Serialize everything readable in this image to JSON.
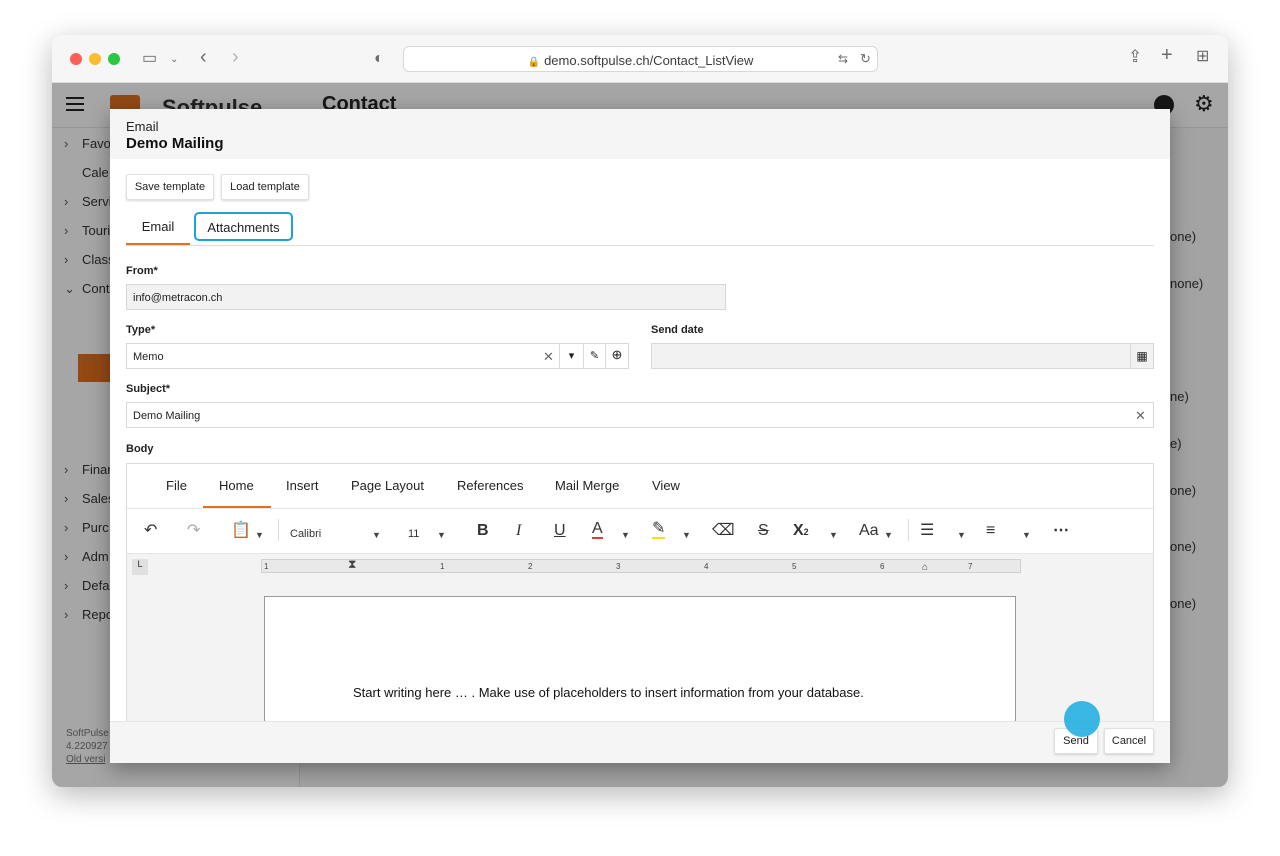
{
  "browser": {
    "url": "demo.softpulse.ch/Contact_ListView"
  },
  "app": {
    "logo_text": "Softpulse",
    "page_title": "Contact"
  },
  "sidebar": {
    "items": [
      "Favo",
      "Cale",
      "Servi",
      "Touri",
      "Class",
      "Cont",
      "Finar",
      "Sales",
      "Purc",
      "Adm",
      "Defa",
      "Repo"
    ],
    "footer": [
      "SoftPulse",
      "4.220927",
      "Old versi"
    ]
  },
  "background_fragments": [
    "one)",
    "none)",
    "ne)",
    "e)",
    "one)",
    "one)",
    "one)"
  ],
  "modal": {
    "kind": "Email",
    "title": "Demo Mailing",
    "save_template": "Save template",
    "load_template": "Load template",
    "tabs": {
      "email": "Email",
      "attachments": "Attachments"
    },
    "from": {
      "label": "From*",
      "value": "info@metracon.ch"
    },
    "type": {
      "label": "Type*",
      "value": "Memo"
    },
    "send_date": {
      "label": "Send date",
      "value": ""
    },
    "subject": {
      "label": "Subject*",
      "value": "Demo Mailing"
    },
    "body": {
      "label": "Body",
      "menu": [
        "File",
        "Home",
        "Insert",
        "Page Layout",
        "References",
        "Mail Merge",
        "View"
      ],
      "font_name": "Calibri",
      "font_size": "11",
      "ruler_numbers": [
        "1",
        "1",
        "2",
        "3",
        "4",
        "5",
        "6",
        "7"
      ],
      "text": "Start writing here … . Make use of placeholders to insert information from your database."
    },
    "send": "Send",
    "cancel": "Cancel"
  },
  "colors": {
    "accent": "#e07020",
    "focus": "#19a3d9"
  }
}
